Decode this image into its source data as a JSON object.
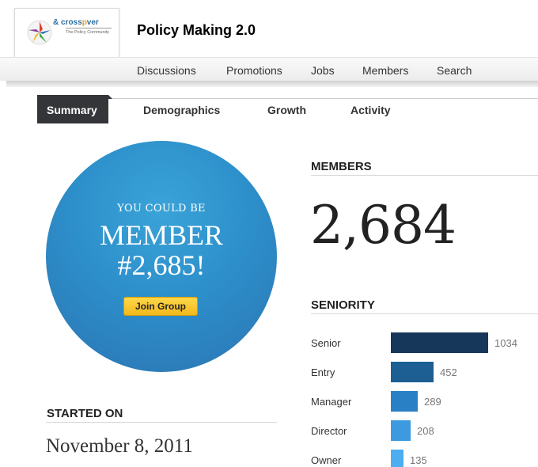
{
  "header": {
    "logo": {
      "name_part1": "& cross",
      "name_accent": "p",
      "name_part2": "ver",
      "tagline": "The Policy Community"
    },
    "group_title": "Policy Making 2.0"
  },
  "nav": {
    "items": [
      {
        "label": "Discussions"
      },
      {
        "label": "Promotions"
      },
      {
        "label": "Jobs"
      },
      {
        "label": "Members"
      },
      {
        "label": "Search"
      }
    ]
  },
  "tabs": {
    "active": "Summary",
    "items": [
      {
        "label": "Summary"
      },
      {
        "label": "Demographics"
      },
      {
        "label": "Growth"
      },
      {
        "label": "Activity"
      }
    ]
  },
  "promo": {
    "line1": "YOU COULD BE",
    "line2": "MEMBER",
    "line3": "#2,685!",
    "button_label": "Join Group"
  },
  "started": {
    "label": "STARTED ON",
    "date": "November 8, 2011"
  },
  "members": {
    "label": "MEMBERS",
    "count": "2,684"
  },
  "seniority": {
    "label": "SENIORITY",
    "colors": [
      "#17375a",
      "#1d5f92",
      "#2a80c5",
      "#3d9ae0",
      "#4cadf0"
    ]
  },
  "chart_data": {
    "type": "bar",
    "orientation": "horizontal",
    "title": "SENIORITY",
    "categories": [
      "Senior",
      "Entry",
      "Manager",
      "Director",
      "Owner"
    ],
    "values": [
      1034,
      452,
      289,
      208,
      135
    ]
  }
}
